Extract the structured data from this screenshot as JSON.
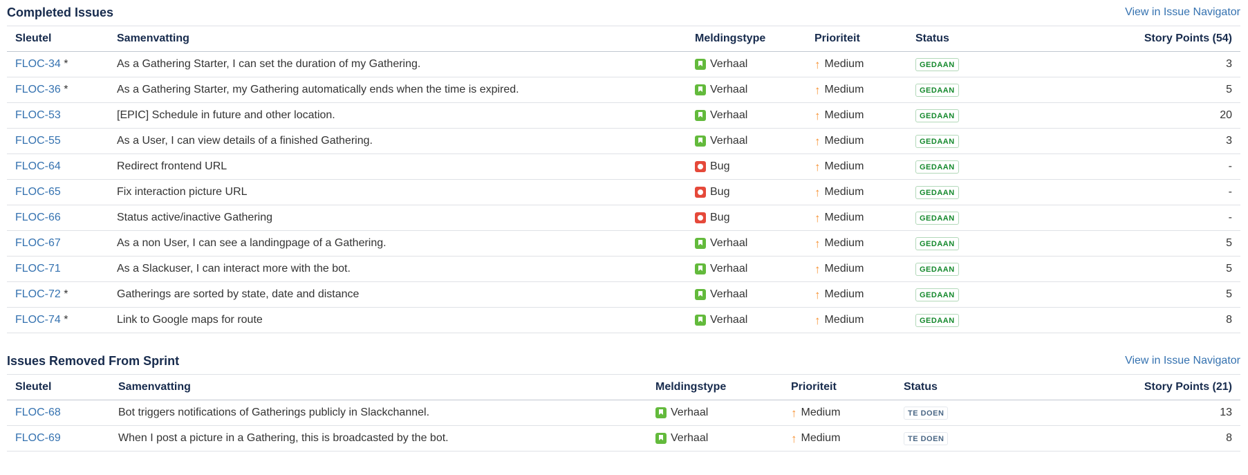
{
  "completed": {
    "title": "Completed Issues",
    "nav_link": "View in Issue Navigator",
    "headers": {
      "key": "Sleutel",
      "summary": "Samenvatting",
      "type": "Meldingstype",
      "priority": "Prioriteit",
      "status": "Status",
      "points": "Story Points (54)"
    },
    "rows": [
      {
        "key": "FLOC-34",
        "mark": " *",
        "summary": "As a Gathering Starter, I can set the duration of my Gathering.",
        "type": "Verhaal",
        "type_icon": "story-icon",
        "priority": "Medium",
        "status": "GEDAAN",
        "points": "3"
      },
      {
        "key": "FLOC-36",
        "mark": " *",
        "summary": "As a Gathering Starter, my Gathering automatically ends when the time is expired.",
        "type": "Verhaal",
        "type_icon": "story-icon",
        "priority": "Medium",
        "status": "GEDAAN",
        "points": "5"
      },
      {
        "key": "FLOC-53",
        "mark": "",
        "summary": "[EPIC] Schedule in future and other location.",
        "type": "Verhaal",
        "type_icon": "story-icon",
        "priority": "Medium",
        "status": "GEDAAN",
        "points": "20"
      },
      {
        "key": "FLOC-55",
        "mark": "",
        "summary": "As a User, I can view details of a finished Gathering.",
        "type": "Verhaal",
        "type_icon": "story-icon",
        "priority": "Medium",
        "status": "GEDAAN",
        "points": "3"
      },
      {
        "key": "FLOC-64",
        "mark": "",
        "summary": "Redirect frontend URL",
        "type": "Bug",
        "type_icon": "bug-icon",
        "priority": "Medium",
        "status": "GEDAAN",
        "points": "-"
      },
      {
        "key": "FLOC-65",
        "mark": "",
        "summary": "Fix interaction picture URL",
        "type": "Bug",
        "type_icon": "bug-icon",
        "priority": "Medium",
        "status": "GEDAAN",
        "points": "-"
      },
      {
        "key": "FLOC-66",
        "mark": "",
        "summary": "Status active/inactive Gathering",
        "type": "Bug",
        "type_icon": "bug-icon",
        "priority": "Medium",
        "status": "GEDAAN",
        "points": "-"
      },
      {
        "key": "FLOC-67",
        "mark": "",
        "summary": "As a non User, I can see a landingpage of a Gathering.",
        "type": "Verhaal",
        "type_icon": "story-icon",
        "priority": "Medium",
        "status": "GEDAAN",
        "points": "5"
      },
      {
        "key": "FLOC-71",
        "mark": "",
        "summary": "As a Slackuser, I can interact more with the bot.",
        "type": "Verhaal",
        "type_icon": "story-icon",
        "priority": "Medium",
        "status": "GEDAAN",
        "points": "5"
      },
      {
        "key": "FLOC-72",
        "mark": " *",
        "summary": "Gatherings are sorted by state, date and distance",
        "type": "Verhaal",
        "type_icon": "story-icon",
        "priority": "Medium",
        "status": "GEDAAN",
        "points": "5"
      },
      {
        "key": "FLOC-74",
        "mark": " *",
        "summary": "Link to Google maps for route",
        "type": "Verhaal",
        "type_icon": "story-icon",
        "priority": "Medium",
        "status": "GEDAAN",
        "points": "8"
      }
    ]
  },
  "removed": {
    "title": "Issues Removed From Sprint",
    "nav_link": "View in Issue Navigator",
    "headers": {
      "key": "Sleutel",
      "summary": "Samenvatting",
      "type": "Meldingstype",
      "priority": "Prioriteit",
      "status": "Status",
      "points": "Story Points (21)"
    },
    "rows": [
      {
        "key": "FLOC-68",
        "mark": "",
        "summary": "Bot triggers notifications of Gatherings publicly in Slackchannel.",
        "type": "Verhaal",
        "type_icon": "story-icon",
        "priority": "Medium",
        "status": "TE DOEN",
        "points": "13"
      },
      {
        "key": "FLOC-69",
        "mark": "",
        "summary": "When I post a picture in a Gathering, this is broadcasted by the bot.",
        "type": "Verhaal",
        "type_icon": "story-icon",
        "priority": "Medium",
        "status": "TE DOEN",
        "points": "8"
      }
    ]
  },
  "colors": {
    "link": "#3572b0",
    "story": "#63ba3c",
    "bug": "#e5493a",
    "priority_medium": "#f79232",
    "done": "#14892c",
    "todo": "#4a6785"
  }
}
